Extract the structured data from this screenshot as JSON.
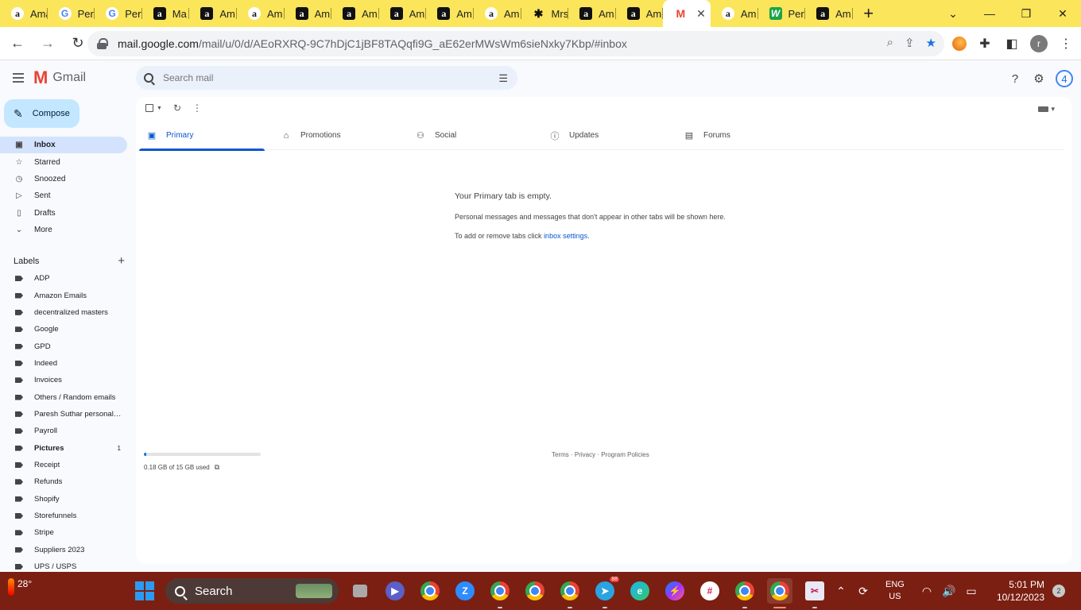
{
  "browser": {
    "tabs": [
      {
        "icon": "amazon-icon",
        "title": "Ama"
      },
      {
        "icon": "google-icon",
        "title": "Perf"
      },
      {
        "icon": "google-icon",
        "title": "Perf"
      },
      {
        "icon": "amazon-icon",
        "title": "Ma"
      },
      {
        "icon": "amazon-icon",
        "title": "Am"
      },
      {
        "icon": "amazon-icon",
        "title": "Am"
      },
      {
        "icon": "amazon-icon",
        "title": "Am"
      },
      {
        "icon": "amazon-icon",
        "title": "Am"
      },
      {
        "icon": "amazon-icon",
        "title": "Am"
      },
      {
        "icon": "amazon-icon",
        "title": "Am"
      },
      {
        "icon": "amazon-icon",
        "title": "Am"
      },
      {
        "icon": "star-icon",
        "title": "Mrs"
      },
      {
        "icon": "amazon-icon",
        "title": "Am"
      },
      {
        "icon": "amazon-icon",
        "title": "Am"
      },
      {
        "icon": "gmail-icon",
        "title": "",
        "active": true
      },
      {
        "icon": "amazon-icon",
        "title": "Am"
      },
      {
        "icon": "w-icon",
        "title": "Perf"
      },
      {
        "icon": "amazon-icon",
        "title": "Am"
      }
    ],
    "url_host": "mail.google.com",
    "url_path": "/mail/u/0/d/AEoRXRQ-9C7hDjC1jBF8TAQqfi9G_aE62erMWsWm6sieNxky7Kbp/#inbox",
    "profile_initial": "r"
  },
  "gmail": {
    "logo_text": "Gmail",
    "search_placeholder": "Search mail",
    "account_initial": "4",
    "compose_label": "Compose",
    "nav": [
      {
        "icon": "inbox-icon",
        "label": "Inbox",
        "active": true
      },
      {
        "icon": "star-icon",
        "label": "Starred"
      },
      {
        "icon": "clock-icon",
        "label": "Snoozed"
      },
      {
        "icon": "send-icon",
        "label": "Sent"
      },
      {
        "icon": "draft-icon",
        "label": "Drafts"
      },
      {
        "icon": "chevron-down-icon",
        "label": "More"
      }
    ],
    "labels_title": "Labels",
    "labels": [
      {
        "name": "ADP"
      },
      {
        "name": "Amazon Emails"
      },
      {
        "name": "decentralized masters"
      },
      {
        "name": "Google"
      },
      {
        "name": "GPD"
      },
      {
        "name": "Indeed"
      },
      {
        "name": "Invoices"
      },
      {
        "name": "Others / Random emails"
      },
      {
        "name": "Paresh Suthar personal ..."
      },
      {
        "name": "Payroll"
      },
      {
        "name": "Pictures",
        "bold": true,
        "count": "1"
      },
      {
        "name": "Receipt"
      },
      {
        "name": "Refunds"
      },
      {
        "name": "Shopify"
      },
      {
        "name": "Storefunnels"
      },
      {
        "name": "Stripe"
      },
      {
        "name": "Suppliers 2023"
      },
      {
        "name": "UPS / USPS"
      }
    ],
    "category_tabs": [
      {
        "icon": "inbox-icon",
        "label": "Primary",
        "active": true
      },
      {
        "icon": "tag-icon",
        "label": "Promotions"
      },
      {
        "icon": "people-icon",
        "label": "Social"
      },
      {
        "icon": "info-icon",
        "label": "Updates"
      },
      {
        "icon": "forum-icon",
        "label": "Forums"
      }
    ],
    "empty_title": "Your Primary tab is empty.",
    "empty_desc": "Personal messages and messages that don't appear in other tabs will be shown here.",
    "empty_hint_prefix": "To add or remove tabs click ",
    "empty_hint_link": "inbox settings",
    "empty_hint_suffix": ".",
    "storage_text": "0.18 GB of 15 GB used",
    "storage_fraction": 0.012,
    "footer_text": "Terms · Privacy · Program Policies"
  },
  "taskbar": {
    "temperature": "28°",
    "search_label": "Search",
    "lang_top": "ENG",
    "lang_bottom": "US",
    "time": "5:01 PM",
    "date": "10/12/2023",
    "notification_count": "2",
    "telegram_badge": "88"
  },
  "colors": {
    "tabstrip": "#fbe55a",
    "taskbar": "#7b1f12",
    "compose": "#c2e7ff",
    "accent": "#0b57d0"
  }
}
